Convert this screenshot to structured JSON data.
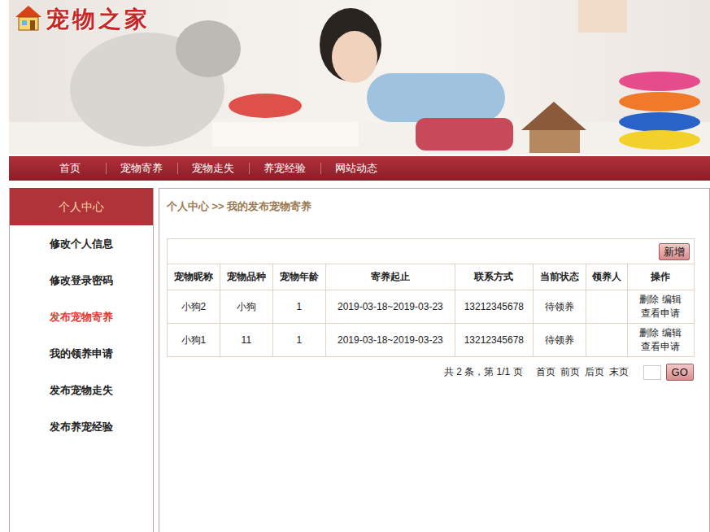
{
  "logo": {
    "text": "宠物之家"
  },
  "nav": [
    {
      "label": "首页"
    },
    {
      "label": "宠物寄养"
    },
    {
      "label": "宠物走失"
    },
    {
      "label": "养宠经验"
    },
    {
      "label": "网站动态"
    }
  ],
  "sidebar": {
    "title": "个人中心",
    "items": [
      {
        "label": "修改个人信息",
        "selected": false
      },
      {
        "label": "修改登录密码",
        "selected": false
      },
      {
        "label": "发布宠物寄养",
        "selected": true
      },
      {
        "label": "我的领养申请",
        "selected": false
      },
      {
        "label": "发布宠物走失",
        "selected": false
      },
      {
        "label": "发布养宠经验",
        "selected": false
      }
    ]
  },
  "breadcrumb": "个人中心 >> 我的发布宠物寄养",
  "table": {
    "add_button": "新增",
    "columns": [
      "宠物昵称",
      "宠物品种",
      "宠物年龄",
      "寄养起止",
      "联系方式",
      "当前状态",
      "领养人",
      "操作"
    ],
    "rows": [
      {
        "cells": [
          "小狗2",
          "小狗",
          "1",
          "2019-03-18~2019-03-23",
          "13212345678",
          "待领养",
          ""
        ],
        "actions": [
          "删除",
          "编辑",
          "查看申请"
        ]
      },
      {
        "cells": [
          "小狗1",
          "11",
          "1",
          "2019-03-18~2019-03-23",
          "13212345678",
          "待领养",
          ""
        ],
        "actions": [
          "删除",
          "编辑",
          "查看申请"
        ]
      }
    ]
  },
  "pagination": {
    "summary": "共 2 条，第 1/1 页",
    "links": [
      "首页",
      "前页",
      "后页",
      "末页"
    ],
    "go": "GO"
  }
}
